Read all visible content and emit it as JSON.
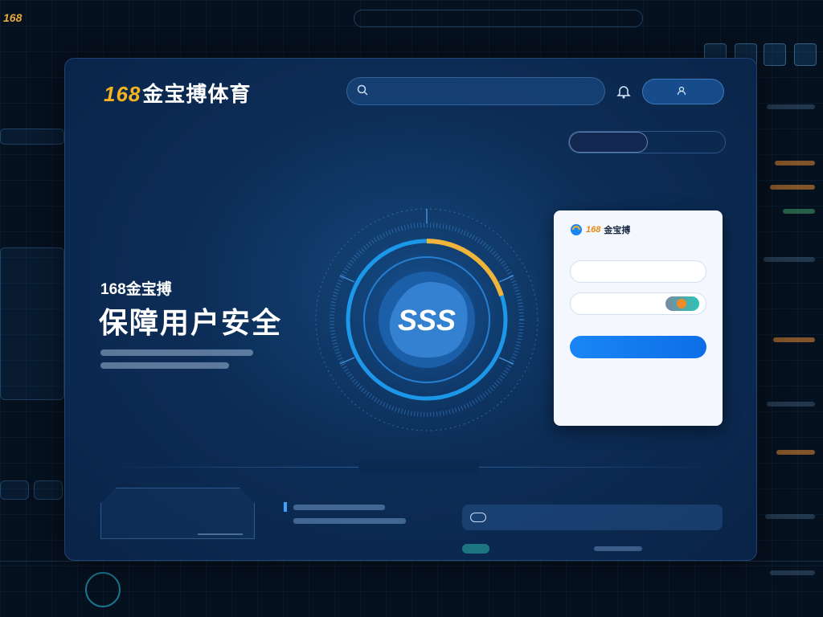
{
  "background": {
    "logo": "168"
  },
  "header": {
    "brand_num": "168",
    "brand_text": "金宝搏体育",
    "search_placeholder": "",
    "search_icon": "search-icon",
    "bell_icon": "bell-icon",
    "login_label": ""
  },
  "section": {
    "label": ""
  },
  "tabs": [
    {
      "label": ""
    },
    {
      "label": ""
    }
  ],
  "hero": {
    "subtitle": "168金宝搏",
    "title": "保障用户安全"
  },
  "emblem": {
    "label": "SSS",
    "ring_color": "#1fa8ff",
    "accent_color": "#f0b43a"
  },
  "login_card": {
    "brand_num": "168",
    "brand_text": "金宝搏",
    "title": "",
    "username_placeholder": "",
    "password_placeholder": "",
    "remember_label": "",
    "forgot_label": "",
    "submit_label": "",
    "footer": ""
  },
  "divider": {
    "label": ""
  },
  "bottom": {
    "card_title": "",
    "card_tag": "",
    "right_heading": "",
    "pill_left": "",
    "pill_right": "",
    "row2_label": ""
  },
  "colors": {
    "accent": "#1a86f5",
    "brand_orange": "#f5b321",
    "danger": "#e04a4a"
  }
}
